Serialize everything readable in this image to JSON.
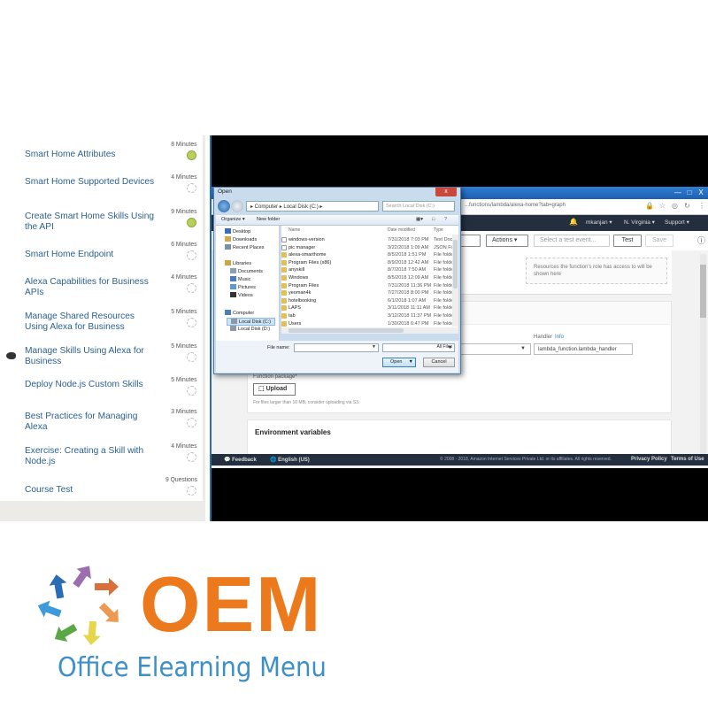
{
  "sidebar": {
    "current_index": 2,
    "lessons": [
      {
        "title": "Smart Home Attributes",
        "duration": "8 Minutes",
        "status": "completed"
      },
      {
        "title": "Smart Home Supported Devices",
        "duration": "4 Minutes",
        "status": "not-started"
      },
      {
        "title": "Create Smart Home Skills Using the API",
        "duration": "9 Minutes",
        "status": "completed"
      },
      {
        "title": "Smart Home Endpoint",
        "duration": "6 Minutes",
        "status": "not-started"
      },
      {
        "title": "Alexa Capabilities for Business APIs",
        "duration": "4 Minutes",
        "status": "not-started"
      },
      {
        "title": "Manage Shared Resources Using Alexa for Business",
        "duration": "5 Minutes",
        "status": "not-started"
      },
      {
        "title": "Manage Skills Using Alexa for Business",
        "duration": "5 Minutes",
        "status": "not-started"
      },
      {
        "title": "Deploy Node.js Custom Skills",
        "duration": "5 Minutes",
        "status": "not-started"
      },
      {
        "title": "Best Practices for Managing Alexa",
        "duration": "3 Minutes",
        "status": "not-started"
      },
      {
        "title": "Exercise: Creating a Skill with Node.js",
        "duration": "4 Minutes",
        "status": "not-started"
      },
      {
        "title": "Course Test",
        "duration": "9 Questions",
        "status": "not-started"
      }
    ]
  },
  "browser": {
    "url": "...functions/lambda/alexa-home?tab=graph",
    "window_controls": [
      "—",
      "□",
      "X"
    ],
    "aws_nav": {
      "user": "mkanjan ▾",
      "region": "N. Virginia ▾",
      "support": "Support ▾"
    },
    "toolbar": {
      "qualifiers": "s ▾",
      "actions": "Actions ▾",
      "test_event_placeholder": "Select a test event...",
      "test": "Test",
      "save": "Save"
    },
    "resource_note": "Resources the function's role has access to will be shown here",
    "handler_label": "Handler",
    "handler_info": "Info",
    "handler_value": "lambda_function.lambda_handler",
    "function_package_label": "Function package*",
    "upload_label": "Upload",
    "upload_hint": "For files larger than 10 MB, consider uploading via S3.",
    "env_vars_title": "Environment variables",
    "footer": {
      "feedback": "Feedback",
      "language": "English (US)",
      "copyright": "© 2008 - 2018, Amazon Internet Services Private Ltd. or its affiliates. All rights reserved.",
      "privacy": "Privacy Policy",
      "terms": "Terms of Use"
    }
  },
  "dialog": {
    "title": "Open",
    "close": "x",
    "breadcrumb": "▸ Computer ▸ Local Disk (C:) ▸",
    "search_placeholder": "Search Local Disk (C:)",
    "organize": "Organize ▾",
    "new_folder": "New folder",
    "tree": [
      {
        "label": "Desktop",
        "icon": "desktop-icon"
      },
      {
        "label": "Downloads",
        "icon": "downloads-icon"
      },
      {
        "label": "Recent Places",
        "icon": "recent-places-icon"
      },
      {
        "label": "Libraries",
        "icon": "libraries-icon"
      },
      {
        "label": "Documents",
        "icon": "documents-icon"
      },
      {
        "label": "Music",
        "icon": "music-icon"
      },
      {
        "label": "Pictures",
        "icon": "pictures-icon"
      },
      {
        "label": "Videos",
        "icon": "videos-icon"
      },
      {
        "label": "Computer",
        "icon": "computer-icon"
      },
      {
        "label": "Local Disk (C:)",
        "icon": "drive-icon",
        "selected": true
      },
      {
        "label": "Local Disk (D:)",
        "icon": "drive-icon"
      }
    ],
    "columns": [
      "Name",
      "Date modified",
      "Type"
    ],
    "files": [
      {
        "name": "windows-version",
        "date": "7/31/2018 7:03 PM",
        "type": "Text Doc",
        "kind": "doc"
      },
      {
        "name": "pic manager",
        "date": "3/22/2018 1:09 AM",
        "type": "JSON File",
        "kind": "doc"
      },
      {
        "name": "alexa-smarthome",
        "date": "8/5/2018 1:51 PM",
        "type": "File folder",
        "kind": "folder"
      },
      {
        "name": "Program Files (x86)",
        "date": "8/9/2018 12:42 AM",
        "type": "File folder",
        "kind": "folder"
      },
      {
        "name": "anyskill",
        "date": "8/7/2018 7:50 AM",
        "type": "File folder",
        "kind": "folder"
      },
      {
        "name": "Windows",
        "date": "8/5/2018 12:09 AM",
        "type": "File folder",
        "kind": "folder"
      },
      {
        "name": "Program Files",
        "date": "7/31/2018 11:36 PM",
        "type": "File folder",
        "kind": "folder"
      },
      {
        "name": "yeoman4k",
        "date": "7/27/2018 8:00 PM",
        "type": "File folder",
        "kind": "folder"
      },
      {
        "name": "hotelbooking",
        "date": "6/1/2018 1:07 AM",
        "type": "File folder",
        "kind": "folder"
      },
      {
        "name": "LAPS",
        "date": "3/11/2018 11:11 AM",
        "type": "File folder",
        "kind": "folder"
      },
      {
        "name": "tab",
        "date": "3/12/2018 11:37 PM",
        "type": "File folder",
        "kind": "folder"
      },
      {
        "name": "Users",
        "date": "1/30/2018 6:47 PM",
        "type": "File folder",
        "kind": "folder"
      }
    ],
    "filename_label": "File name:",
    "filename_value": "",
    "filetype": "All Files",
    "open": "Open",
    "cancel": "Cancel"
  },
  "logo": {
    "mark": "OEM",
    "tagline": "Office Elearning Menu",
    "colors": {
      "orange": "#ec7a1c",
      "blue": "#3d8fc8"
    },
    "arrow_colors": [
      "#2a6db5",
      "#9b6eb0",
      "#d9703c",
      "#ec9a52",
      "#e7d64b",
      "#5aa845",
      "#3d9bdc"
    ]
  },
  "colors": {
    "lesson_link": "#2a5f8f",
    "completed": "#b8cf5a",
    "aws_nav": "#232f3e"
  }
}
